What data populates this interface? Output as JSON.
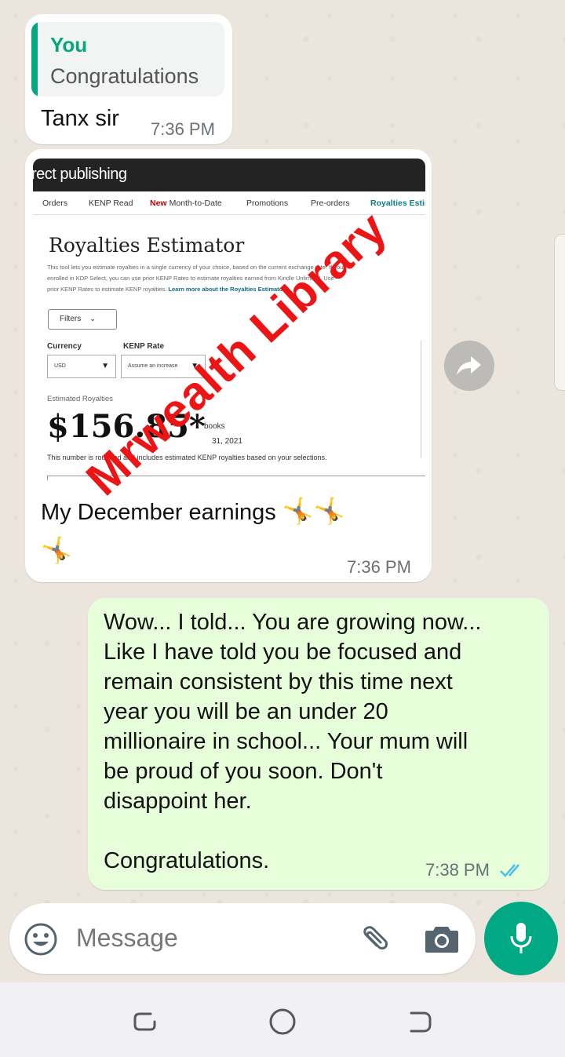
{
  "reply_message": {
    "quote_author": "You",
    "quote_text": "Congratulations",
    "text": "Tanx sir",
    "time": "7:36 PM"
  },
  "image_message": {
    "screenshot": {
      "header": "rect publishing",
      "nav": [
        "Orders",
        "KENP Read",
        "New",
        "Month-to-Date",
        "Promotions",
        "Pre-orders",
        "Royalties Estir"
      ],
      "title": "Royalties Estimator",
      "desc_line1": "This tool lets you estimate royalties in a single currency of your choice, based on the current exchange rate. If you",
      "desc_line2": "enrolled in KDP Select, you can use prior KENP Rates to estimate royalties earned from Kindle Unlimited. Use",
      "desc_line3_plain": "prior KENP Rates to estimate KENP royalties.",
      "desc_link": "Learn more about the Royalties Estimator",
      "filters": "Filters",
      "currency_label": "Currency",
      "currency_value": "USD",
      "kenp_label": "KENP Rate",
      "kenp_value": "Assume an increase",
      "est_label": "Estimated Royalties",
      "est_value": "$156.85*",
      "est_side": "books",
      "est_date": "31, 2021",
      "est_note": "This number is rounded and includes estimated KENP royalties based on your selections."
    },
    "watermark": "Mrwealth Library",
    "caption": "My December earnings",
    "time": "7:36 PM"
  },
  "outgoing_message": {
    "text": "Wow... I told... You are growing now...\nLike I have told you be focused and\nremain consistent by this time next\nyear you will be an under 20\nmillionaire in school... Your mum will\nbe proud of you soon. Don't\ndisappoint her.\n\nCongratulations.",
    "time": "7:38 PM",
    "status": "read"
  },
  "composer": {
    "placeholder": "Message"
  },
  "icons": {
    "emoji": "smiley-icon",
    "attach": "paperclip-icon",
    "camera": "camera-icon",
    "mic": "microphone-icon",
    "forward": "forward-icon"
  },
  "colors": {
    "accent": "#00a884",
    "outgoing_bubble": "#e6ffda",
    "quote_accent": "#06a77d",
    "read_ticks": "#53bdeb",
    "watermark": "#ec1414"
  }
}
